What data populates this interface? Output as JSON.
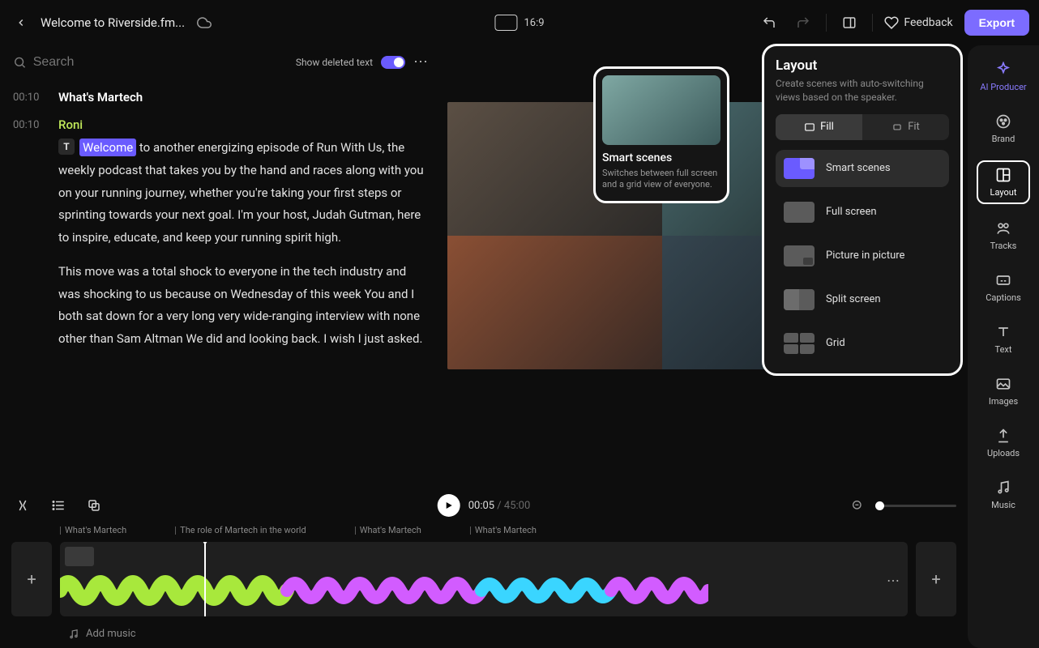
{
  "topbar": {
    "title": "Welcome to Riverside.fm...",
    "aspect": "16:9",
    "feedback_label": "Feedback",
    "export_label": "Export"
  },
  "search": {
    "placeholder": "Search",
    "deleted_label": "Show deleted text"
  },
  "transcript": {
    "sections": [
      {
        "time": "00:10",
        "title": "What's Martech"
      }
    ],
    "speaker_time": "00:10",
    "speaker": "Roni",
    "highlight": "Welcome",
    "body1_rest": " to another energizing episode of Run With Us, the weekly podcast that takes you by the hand and races along with you on your running journey, whether you're taking your first steps or sprinting towards your next goal. I'm your host, Judah Gutman, here to inspire, educate, and keep your running spirit high.",
    "body2": "This move was a total shock to everyone in the tech industry and was shocking to us because on Wednesday of this week You and I both sat down for a very long very wide-ranging interview with none other than Sam Altman We did and looking back. I wish I just asked."
  },
  "scene_card": {
    "title": "Smart scenes",
    "desc": "Switches between full screen and a grid view of everyone."
  },
  "layout_panel": {
    "title": "Layout",
    "desc": "Create scenes with auto-switching views based on the speaker.",
    "fill": "Fill",
    "fit": "Fit",
    "items": [
      "Smart scenes",
      "Full screen",
      "Picture in picture",
      "Split screen",
      "Grid"
    ]
  },
  "rail": {
    "ai": "AI Producer",
    "brand": "Brand",
    "layout": "Layout",
    "tracks": "Tracks",
    "captions": "Captions",
    "text": "Text",
    "images": "Images",
    "uploads": "Uploads",
    "music": "Music"
  },
  "timeline": {
    "current": "00:05",
    "duration": "45:00",
    "chapters": [
      "What's Martech",
      "The role of Martech in the world",
      "What's Martech",
      "What's Martech"
    ],
    "add_music": "Add music"
  }
}
